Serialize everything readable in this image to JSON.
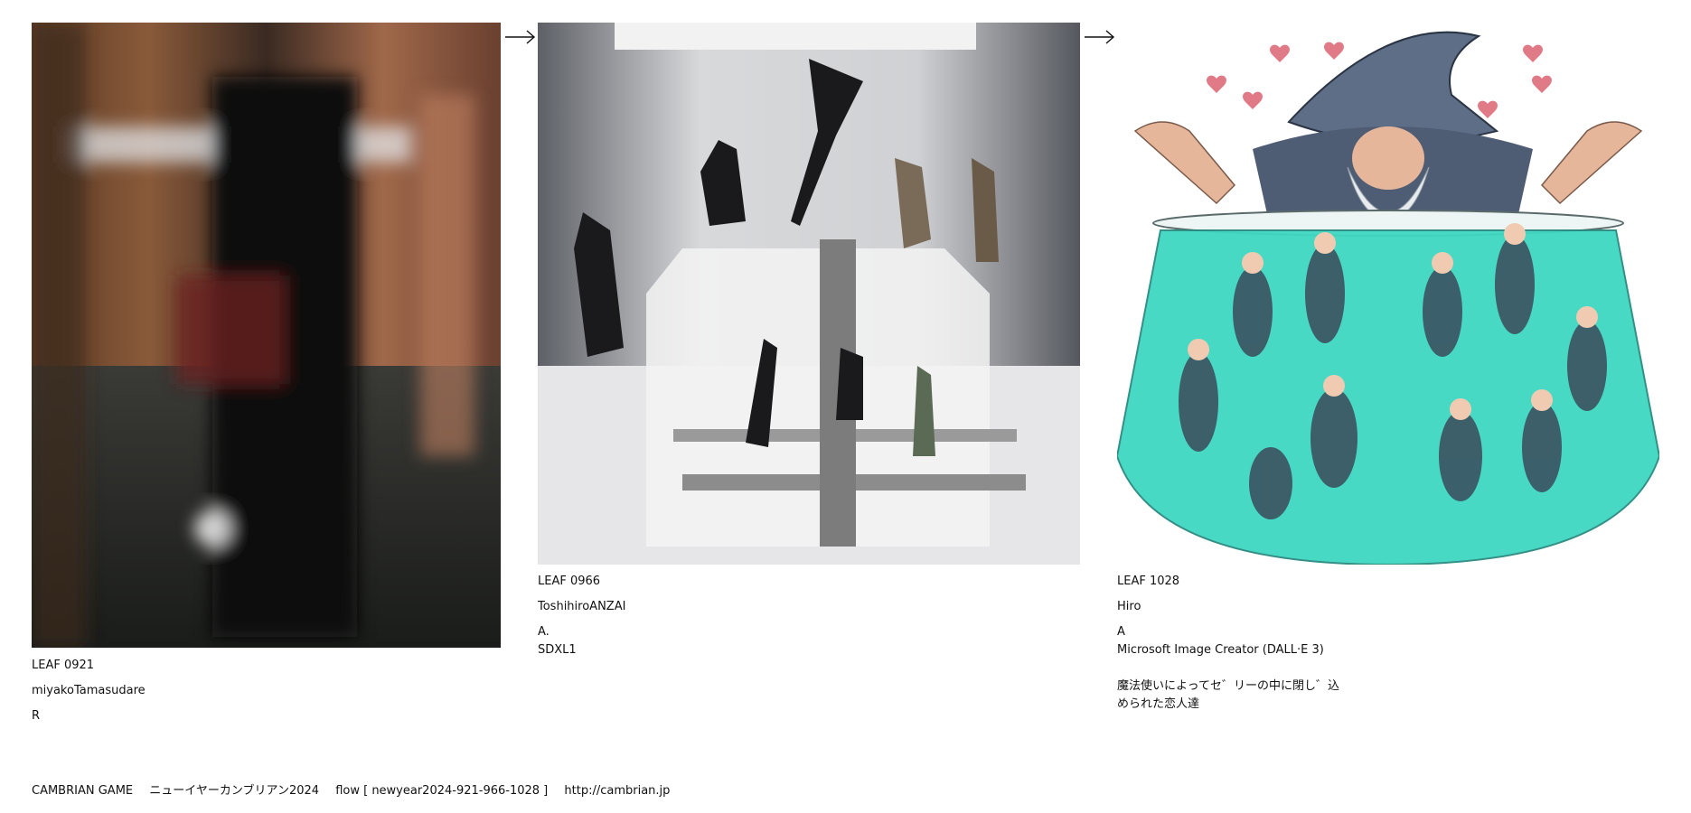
{
  "items": [
    {
      "leaf": "LEAF 0921",
      "author": "miyakoTamasudare",
      "type": "R",
      "tool": "",
      "title_lines": []
    },
    {
      "leaf": "LEAF 0966",
      "author": "ToshihiroANZAI",
      "type": "A.",
      "tool": "SDXL1",
      "title_lines": []
    },
    {
      "leaf": "LEAF 1028",
      "author": "Hiro",
      "type": "A",
      "tool": "Microsoft Image Creator (DALL·E 3)",
      "title_lines": [
        "魔法使いによってセ゛リーの中に閉し゛込",
        "められた恋人達"
      ]
    }
  ],
  "footer": {
    "brand": "CAMBRIAN GAME",
    "event": "ニューイヤーカンブリアン2024",
    "flow": "flow [ newyear2024-921-966-1028 ]",
    "url": "http://cambrian.jp"
  },
  "icons": {
    "flow_arrow": "right-arrow-icon"
  },
  "colors": {
    "background": "#ffffff",
    "text": "#111111",
    "jelly": "#3fd8c2"
  }
}
